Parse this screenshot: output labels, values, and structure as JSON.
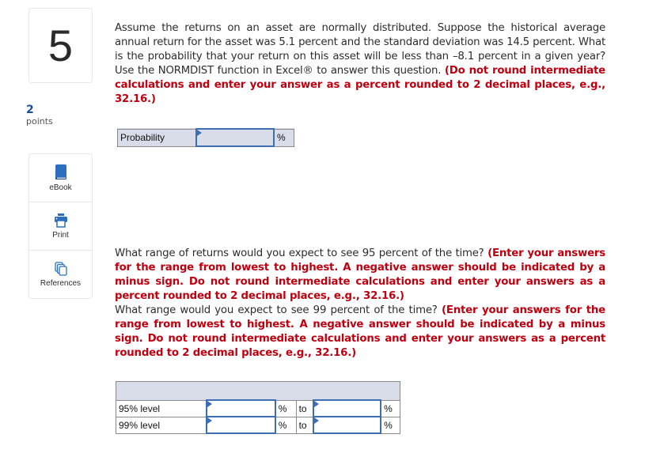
{
  "question": {
    "number": "5",
    "points_value": "2",
    "points_label": "points",
    "part1": {
      "text": "Assume the returns on an asset are normally distributed. Suppose the historical average annual return for the asset was 5.1 percent and the standard deviation was 14.5 percent. What is the probability that your return on this asset will be less than –8.1 percent in a given year? Use the NORMDIST function in Excel® to answer this question. ",
      "instruction": "(Do not round intermediate calculations and enter your answer as a percent rounded to 2 decimal places, e.g., 32.16.)"
    },
    "part2": {
      "text_95": "What range of returns would you expect to see 95 percent of the time? ",
      "instruction_95": "(Enter your answers for the range from lowest to highest. A negative answer should be indicated by a minus sign. Do not round intermediate calculations and enter your answers as a percent rounded to 2 decimal places, e.g., 32.16.)",
      "text_99": "What range would you expect to see 99 percent of the time? ",
      "instruction_99": "(Enter your answers for the range from lowest to highest. A negative answer should be indicated by a minus sign. Do not round intermediate calculations and enter your answers as a percent rounded to 2 decimal places, e.g., 32.16.)"
    }
  },
  "tools": [
    {
      "label": "eBook",
      "icon": "book-icon"
    },
    {
      "label": "Print",
      "icon": "printer-icon"
    },
    {
      "label": "References",
      "icon": "references-icon"
    }
  ],
  "probability_table": {
    "label": "Probability",
    "value": "",
    "unit": "%"
  },
  "range_table": {
    "rows": [
      {
        "label": "95% level",
        "low": "",
        "unit1": "%",
        "sep": "to",
        "high": "",
        "unit2": "%"
      },
      {
        "label": "99% level",
        "low": "",
        "unit1": "%",
        "sep": "to",
        "high": "",
        "unit2": "%"
      }
    ]
  }
}
